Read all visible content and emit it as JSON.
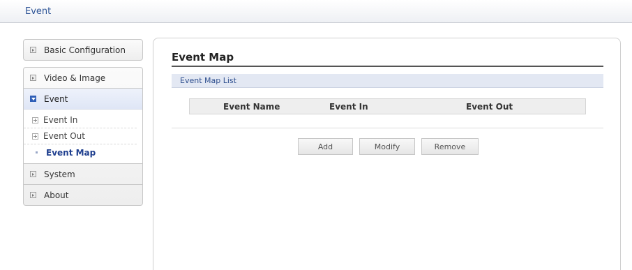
{
  "header": {
    "title": "Event"
  },
  "sidebar": {
    "basic": "Basic Configuration",
    "video": "Video & Image",
    "event": "Event",
    "event_items": [
      "Event In",
      "Event Out",
      "Event Map"
    ],
    "system": "System",
    "about": "About"
  },
  "main": {
    "title": "Event Map",
    "section": "Event Map List",
    "columns": [
      "Event Name",
      "Event In",
      "Event Out"
    ],
    "buttons": {
      "add": "Add",
      "modify": "Modify",
      "remove": "Remove"
    }
  },
  "colors": {
    "accent": "#2f5597",
    "active_icon": "#2f5fb7",
    "section_bg": "#e3e8f3"
  }
}
